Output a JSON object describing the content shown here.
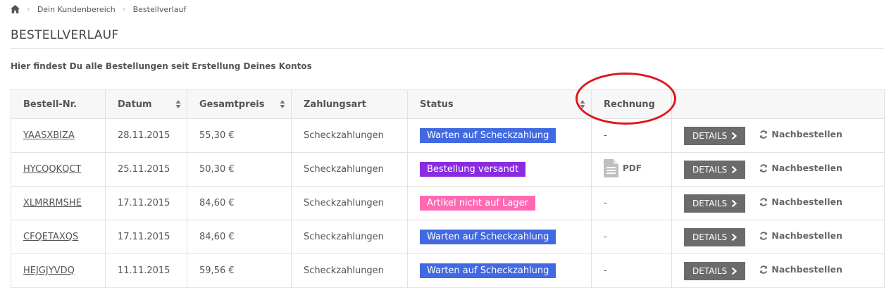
{
  "breadcrumb": {
    "items": [
      "Dein Kundenbereich",
      "Bestellverlauf"
    ]
  },
  "page": {
    "title": "BESTELLVERLAUF",
    "intro": "Hier findest Du alle Bestellungen seit Erstellung Deines Kontos"
  },
  "table": {
    "headers": [
      "Bestell-Nr.",
      "Datum",
      "Gesamtpreis",
      "Zahlungsart",
      "Status",
      "Rechnung",
      ""
    ],
    "rows": [
      {
        "order_no": "YAASXBIZA",
        "date": "28.11.2015",
        "total": "55,30 €",
        "payment": "Scheckzahlungen",
        "status": "Warten auf Scheckzahlung",
        "status_color": "#4169e1",
        "invoice": "-"
      },
      {
        "order_no": "HYCQQKQCT",
        "date": "25.11.2015",
        "total": "50,30 €",
        "payment": "Scheckzahlungen",
        "status": "Bestellung versandt",
        "status_color": "#8a2be2",
        "invoice": "PDF"
      },
      {
        "order_no": "XLMRRMSHE",
        "date": "17.11.2015",
        "total": "84,60 €",
        "payment": "Scheckzahlungen",
        "status": "Artikel nicht auf Lager",
        "status_color": "#ff69b4",
        "invoice": "-"
      },
      {
        "order_no": "CFQETAXQS",
        "date": "17.11.2015",
        "total": "84,60 €",
        "payment": "Scheckzahlungen",
        "status": "Warten auf Scheckzahlung",
        "status_color": "#4169e1",
        "invoice": "-"
      },
      {
        "order_no": "HEJGJYVDQ",
        "date": "11.11.2015",
        "total": "59,56 €",
        "payment": "Scheckzahlungen",
        "status": "Warten auf Scheckzahlung",
        "status_color": "#4169e1",
        "invoice": "-"
      }
    ]
  },
  "actions": {
    "details_label": "DETAILS",
    "reorder_label": "Nachbestellen"
  },
  "icons": {
    "home": "home-icon",
    "sort": "sort-icon",
    "pdf": "file-pdf-icon",
    "chevron": "chevron-right-icon",
    "refresh": "refresh-icon"
  },
  "colors": {
    "annotation": "#e0161a",
    "button": "#6b6b6b"
  }
}
